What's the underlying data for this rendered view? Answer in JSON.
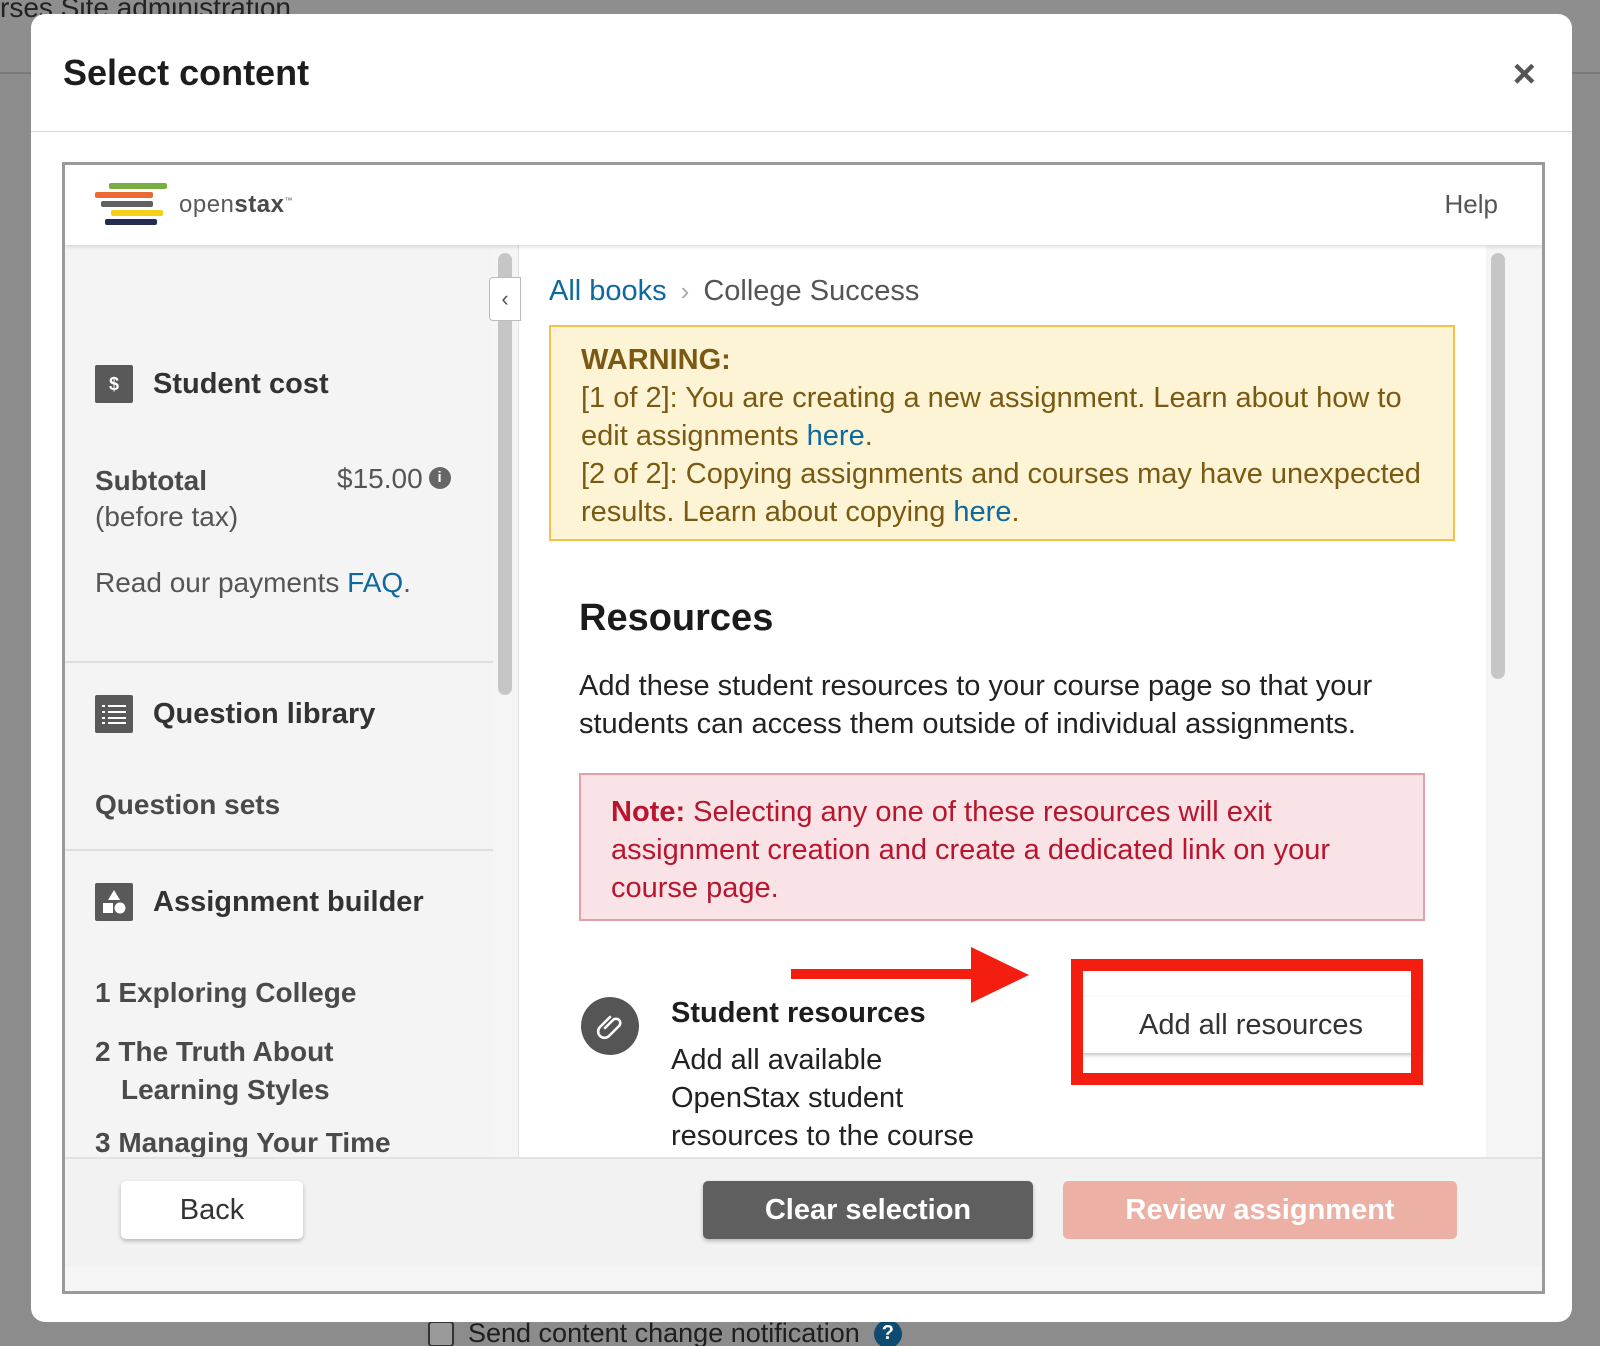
{
  "background": {
    "breadcrumb": "rses   Site administration",
    "notification_label": "Send content change notification",
    "help_glyph": "?"
  },
  "modal": {
    "title": "Select content",
    "close_glyph": "×"
  },
  "openstax": {
    "brand_light": "open",
    "brand_bold": "stax",
    "trademark": "™",
    "help_label": "Help",
    "logo_colors": [
      "#77af42",
      "#f4d019",
      "#5f6163",
      "#e96a35",
      "#232d51"
    ]
  },
  "sidebar": {
    "student_cost": {
      "icon": "$",
      "heading": "Student cost",
      "subtotal_label": "Subtotal",
      "subtotal_note": "(before tax)",
      "subtotal_value": "$15.00",
      "info_glyph": "i",
      "faq_prefix": "Read our payments ",
      "faq_link": "FAQ",
      "faq_suffix": "."
    },
    "question_library": {
      "heading": "Question library",
      "item": "Question sets"
    },
    "assignment_builder": {
      "heading": "Assignment builder",
      "chapters": [
        {
          "num": "1",
          "title": "Exploring College"
        },
        {
          "num": "2",
          "title": "The Truth About",
          "title2": "Learning Styles"
        },
        {
          "num": "3",
          "title": "Managing Your Time"
        }
      ]
    },
    "collapse_glyph": "‹"
  },
  "main": {
    "breadcrumb": {
      "root": "All books",
      "separator": "›",
      "current": "College Success"
    },
    "warning": {
      "title": "WARNING:",
      "line1_text": "[1 of 2]: You are creating a new assignment. Learn about how to edit assignments ",
      "line1_link": "here",
      "line1_end": ".",
      "line2_text": "[2 of 2]: Copying assignments and courses may have unexpected results. Learn about copying ",
      "line2_link": "here",
      "line2_end": "."
    },
    "resources": {
      "title": "Resources",
      "description": "Add these student resources to your course page so that your students can access them outside of individual assignments."
    },
    "note": {
      "label": "Note:",
      "text": " Selecting any one of these resources will exit assignment creation and create a dedicated link on your course page."
    },
    "student_resources": {
      "icon_glyph": "⚲",
      "title": "Student resources",
      "description": "Add all available OpenStax student resources to the course",
      "button_label": "Add all resources"
    },
    "annotation_color": "#f31e10"
  },
  "footer": {
    "back_label": "Back",
    "clear_label": "Clear selection",
    "review_label": "Review assignment"
  }
}
